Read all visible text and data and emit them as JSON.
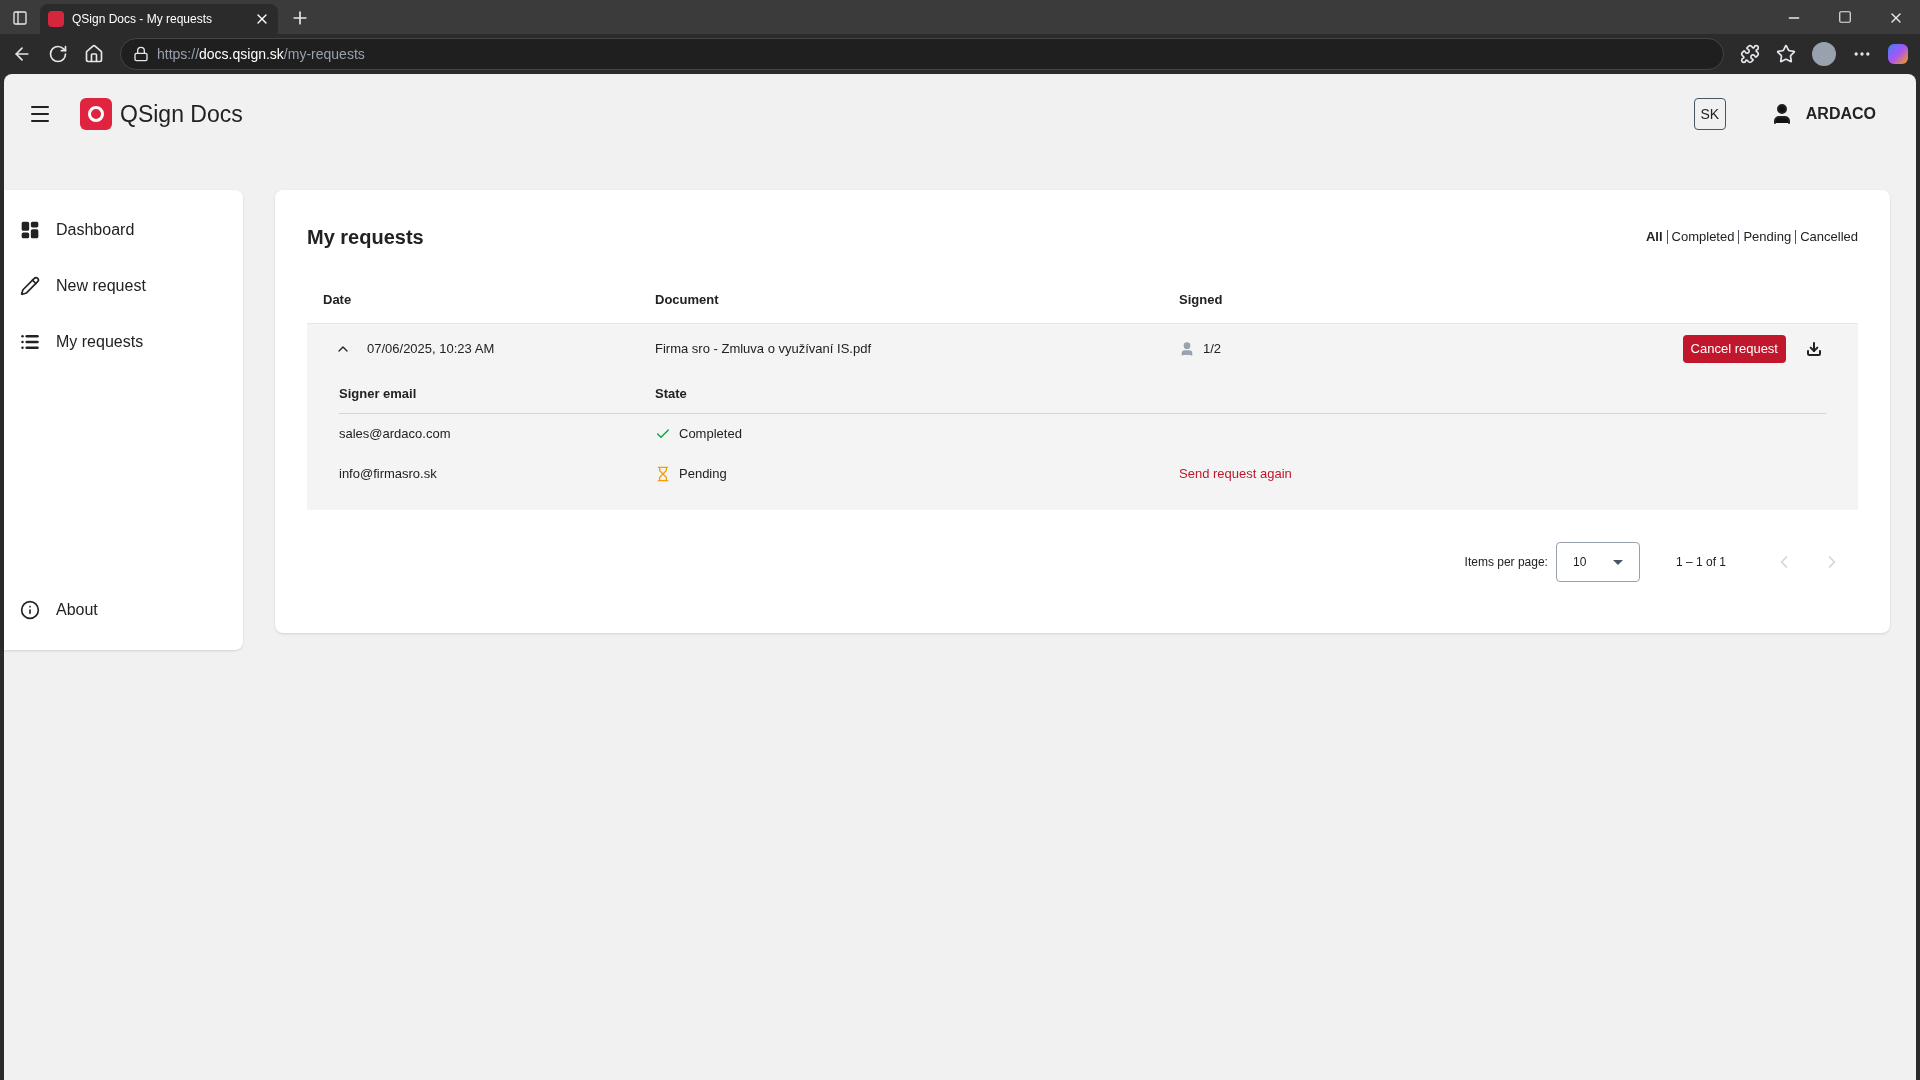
{
  "browser": {
    "tab_title": "QSign Docs - My requests",
    "url_scheme": "https://",
    "url_host": "docs.qsign.sk",
    "url_path": "/my-requests"
  },
  "header": {
    "app_name": "QSign Docs",
    "language": "SK",
    "user": "ARDACO"
  },
  "sidebar": {
    "items": [
      {
        "label": "Dashboard",
        "kind": "dashboard"
      },
      {
        "label": "New request",
        "kind": "new"
      },
      {
        "label": "My requests",
        "kind": "list"
      }
    ],
    "footer_item": {
      "label": "About"
    }
  },
  "main": {
    "title": "My requests",
    "filters": [
      {
        "label": "All",
        "selected": true
      },
      {
        "label": "Completed",
        "selected": false
      },
      {
        "label": "Pending",
        "selected": false
      },
      {
        "label": "Cancelled",
        "selected": false
      }
    ],
    "table": {
      "columns": [
        "Date",
        "Document",
        "Signed"
      ],
      "rows": [
        {
          "expanded": true,
          "date": "07/06/2025, 10:23 AM",
          "document": "Firma sro - Zmluva o využívaní IS.pdf",
          "signed": "1/2",
          "action": "Cancel request",
          "signers": {
            "columns": [
              "Signer email",
              "State"
            ],
            "rows": [
              {
                "email": "sales@ardaco.com",
                "kind": "completed",
                "state": "Completed"
              },
              {
                "email": "info@firmasro.sk",
                "kind": "pending",
                "state": "Pending",
                "action": "Send request again"
              }
            ]
          }
        }
      ]
    },
    "pagination": {
      "label": "Items per page:",
      "page_size": "10",
      "range": "1 – 1 of 1",
      "prev_disabled": true,
      "next_disabled": true
    }
  }
}
